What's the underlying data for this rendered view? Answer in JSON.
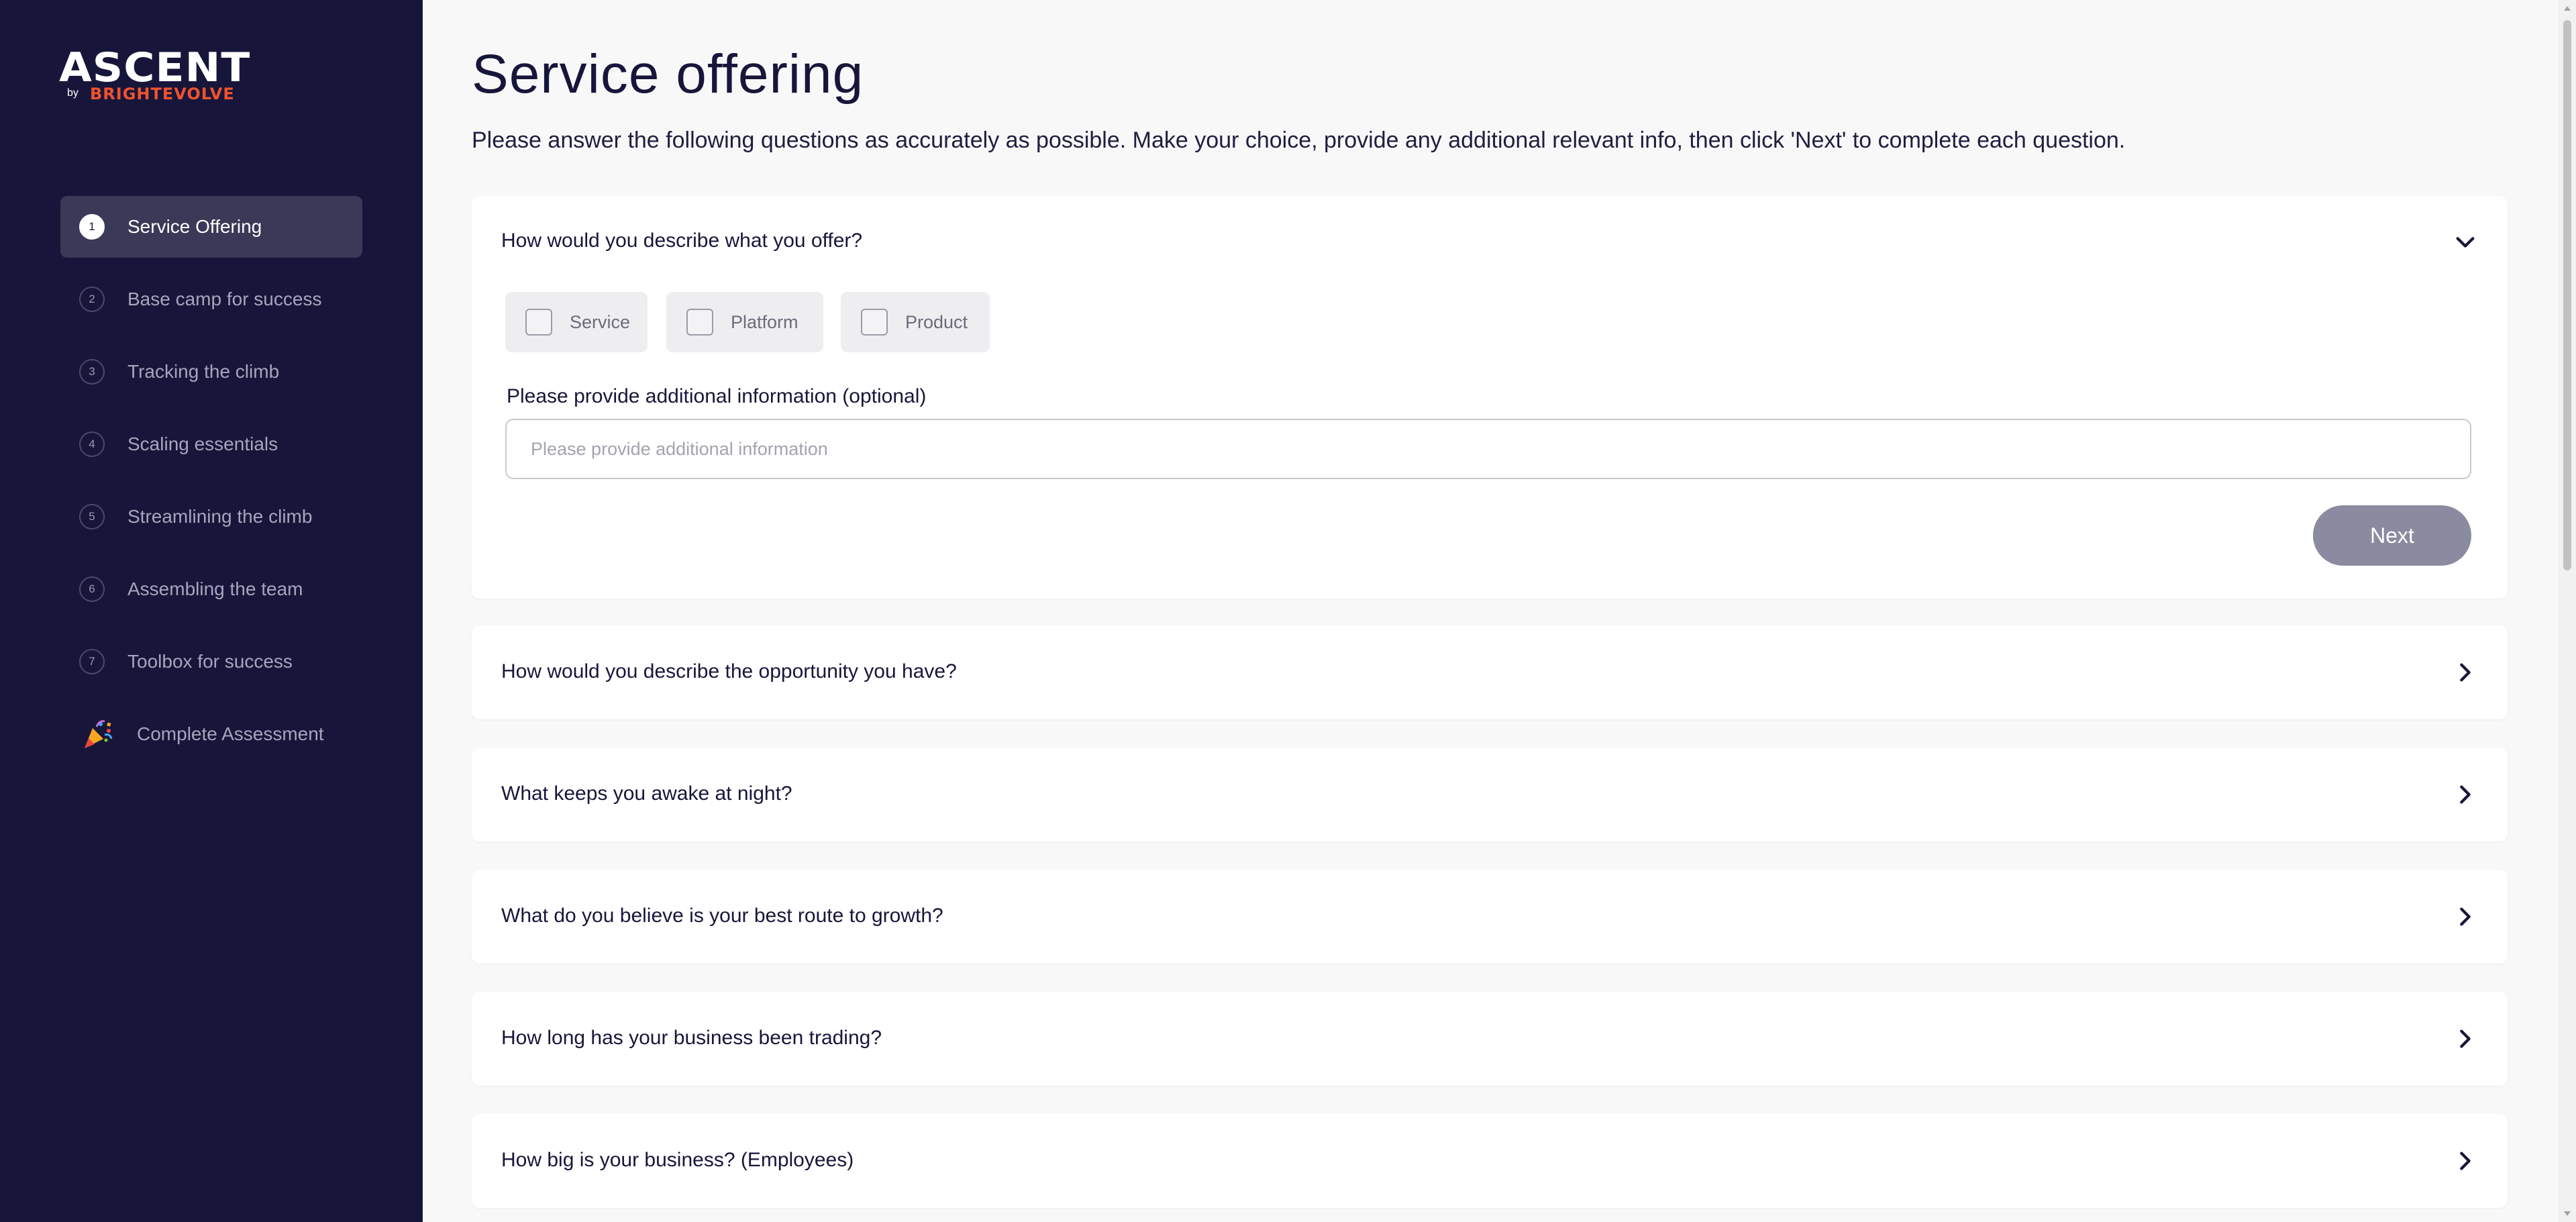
{
  "brand": {
    "name": "ASCENT",
    "by": "by",
    "company": "BRIGHTEVOLVE"
  },
  "sidebar": {
    "items": [
      {
        "num": "1",
        "label": "Service Offering",
        "active": true
      },
      {
        "num": "2",
        "label": "Base camp for success"
      },
      {
        "num": "3",
        "label": "Tracking the climb"
      },
      {
        "num": "4",
        "label": "Scaling essentials"
      },
      {
        "num": "5",
        "label": "Streamlining the climb"
      },
      {
        "num": "6",
        "label": "Assembling the team"
      },
      {
        "num": "7",
        "label": "Toolbox for success"
      }
    ],
    "final": {
      "label": "Complete Assessment",
      "icon": "party-popper-icon"
    }
  },
  "main": {
    "title": "Service offering",
    "intro": "Please answer the following questions as accurately as possible. Make your choice, provide any additional relevant info, then click 'Next' to complete each question.",
    "questions": [
      {
        "text": "How would you describe what you offer?",
        "expanded": true,
        "options": [
          "Service",
          "Platform",
          "Product"
        ],
        "info_label": "Please provide additional information (optional)",
        "info_placeholder": "Please provide additional information",
        "info_value": "",
        "next_label": "Next"
      },
      {
        "text": "How would you describe the opportunity you have?"
      },
      {
        "text": "What keeps you awake at night?"
      },
      {
        "text": "What do you believe is your best route to growth?"
      },
      {
        "text": "How long has your business been trading?"
      },
      {
        "text": "How big is your business? (Employees)"
      }
    ]
  },
  "colors": {
    "sidebar_bg": "#17163a",
    "active_item_bg": "#3a3958",
    "brand_accent": "#f0522e",
    "next_button_bg": "#8a8ba1",
    "page_bg": "#f8f8f9"
  }
}
